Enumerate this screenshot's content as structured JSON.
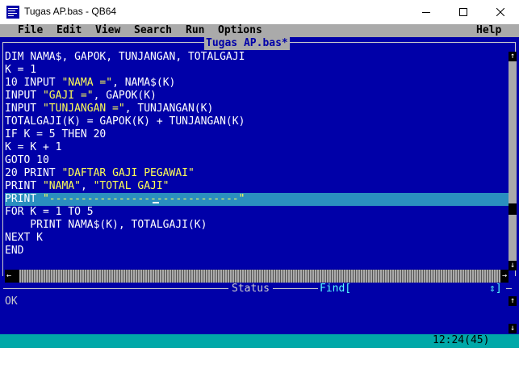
{
  "window": {
    "title": "Tugas AP.bas - QB64",
    "minimize_glyph": "—",
    "maximize_glyph": "☐",
    "close_glyph": "✕"
  },
  "menu": {
    "items": [
      {
        "label": "File"
      },
      {
        "label": "Edit"
      },
      {
        "label": "View"
      },
      {
        "label": "Search"
      },
      {
        "label": "Run"
      },
      {
        "label": "Options"
      }
    ],
    "help": "Help"
  },
  "editor": {
    "file_tab": "Tugas AP.bas*",
    "lines": [
      {
        "text": "DIM NAMA$, GAPOK, TUNJANGAN, TOTALGAJI"
      },
      {
        "text": "K = 1"
      },
      {
        "pre": "10 INPUT ",
        "str": "\"NAMA =\"",
        "post": ", NAMA$(K)"
      },
      {
        "pre": "INPUT ",
        "str": "\"GAJI =\"",
        "post": ", GAPOK(K)"
      },
      {
        "pre": "INPUT ",
        "str": "\"TUNJANGAN =\"",
        "post": ", TUNJANGAN(K)"
      },
      {
        "text": "TOTALGAJI(K) = GAPOK(K) + TUNJANGAN(K)"
      },
      {
        "text": "IF K = 5 THEN 20"
      },
      {
        "text": "K = K + 1"
      },
      {
        "text": "GOTO 10"
      },
      {
        "pre": "20 PRINT ",
        "str": "\"DAFTAR GAJI PEGAWAI\"",
        "post": ""
      },
      {
        "pre": "PRINT ",
        "str": "\"NAMA\"",
        "post": ", ",
        "str2": "\"TOTAL GAJI\""
      },
      {
        "pre": "PRINT ",
        "str": "\"------------------------------\"",
        "post": "",
        "highlight": true
      },
      {
        "text": "FOR K = 1 TO 5"
      },
      {
        "text": "    PRINT NAMA$(K), TOTALGAJI(K)"
      },
      {
        "text": "NEXT K"
      },
      {
        "text": "END"
      }
    ]
  },
  "scroll": {
    "up": "↑",
    "down": "↓",
    "left": "←",
    "right": "→"
  },
  "status": {
    "label": "Status",
    "find_label": "Find[",
    "find_arrows": "⇕]",
    "text": "OK"
  },
  "bottom": {
    "cursor_position": "12:24(45)"
  },
  "colors": {
    "editor_bg": "#0000a8",
    "menu_bg": "#aaaaaa",
    "string_color": "#ffff55",
    "highlight_line": "#2a8fbf",
    "bottom_bar": "#00a8a8"
  }
}
